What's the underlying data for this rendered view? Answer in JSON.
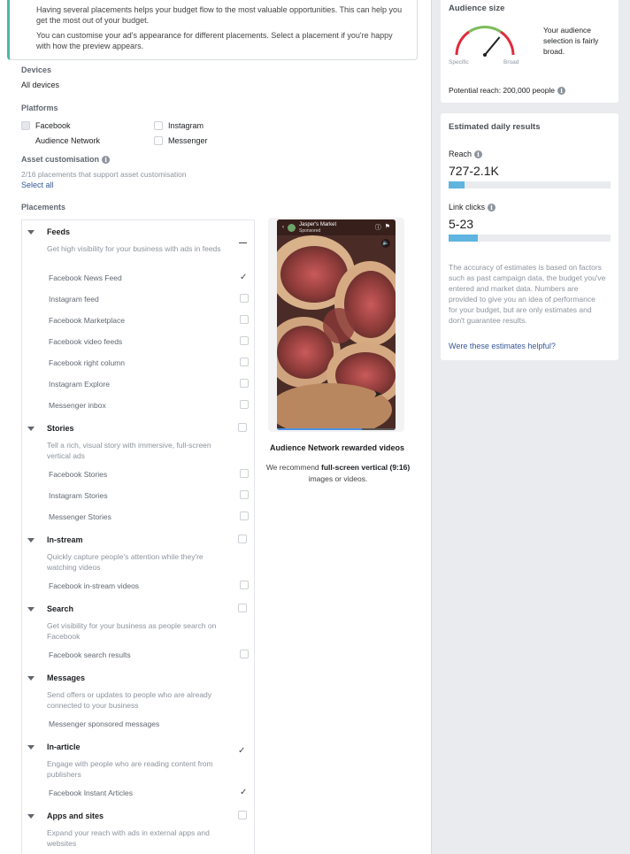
{
  "info_box": {
    "line1": "Having several placements helps your budget flow to the most valuable opportunities. This can help you get the most out of your budget.",
    "line2": "You can customise your ad's appearance for different placements. Select a placement if you're happy with how the preview appears."
  },
  "devices": {
    "label": "Devices",
    "value": "All devices"
  },
  "platforms": {
    "label": "Platforms",
    "items": [
      {
        "label": "Facebook",
        "checked": true
      },
      {
        "label": "Instagram",
        "checked": false
      },
      {
        "label": "Audience Network",
        "checked": false
      },
      {
        "label": "Messenger",
        "checked": false
      }
    ]
  },
  "asset_customisation": {
    "label": "Asset customisation",
    "note": "2/16 placements that support asset customisation",
    "select_all": "Select all"
  },
  "placements": {
    "label": "Placements",
    "groups": [
      {
        "title": "Feeds",
        "desc": "Get high visibility for your business with ads in feeds",
        "items": [
          "Facebook News Feed",
          "Instagram feed",
          "Facebook Marketplace",
          "Facebook video feeds",
          "Facebook right column",
          "Instagram Explore",
          "Messenger inbox"
        ]
      },
      {
        "title": "Stories",
        "desc": "Tell a rich, visual story with immersive, full-screen vertical ads",
        "items": [
          "Facebook Stories",
          "Instagram Stories",
          "Messenger Stories"
        ]
      },
      {
        "title": "In-stream",
        "desc": "Quickly capture people's attention while they're watching videos",
        "items": [
          "Facebook in-stream videos"
        ]
      },
      {
        "title": "Search",
        "desc": "Get visibility for your business as people search on Facebook",
        "items": [
          "Facebook search results"
        ]
      },
      {
        "title": "Messages",
        "desc": "Send offers or updates to people who are already connected to your business",
        "items": [
          "Messenger sponsored messages"
        ]
      },
      {
        "title": "In-article",
        "desc": "Engage with people who are reading content from publishers",
        "items": [
          "Facebook Instant Articles"
        ]
      },
      {
        "title": "Apps and sites",
        "desc": "Expand your reach with ads in external apps and websites",
        "items": []
      }
    ]
  },
  "preview": {
    "page_name": "Jasper's Market",
    "sponsored": "Sponsored",
    "title": "Audience Network rewarded videos",
    "text_before": "We recommend ",
    "text_bold": "full-screen vertical (9:16)",
    "text_after": " images or videos."
  },
  "audience_size": {
    "title": "Audience size",
    "specific": "Specific",
    "broad": "Broad",
    "desc": "Your audience selection is fairly broad.",
    "potential_reach": "Potential reach: 200,000 people",
    "gauge_level": 0.72
  },
  "daily_results": {
    "title": "Estimated daily results",
    "reach_label": "Reach",
    "reach_value": "727-2.1K",
    "reach_fill": 0.1,
    "clicks_label": "Link clicks",
    "clicks_value": "5-23",
    "clicks_fill": 0.18,
    "disclaimer": "The accuracy of estimates is based on factors such as past campaign data, the budget you've entered and market data. Numbers are provided to give you an idea of performance for your budget, but are only estimates and don't guarantee results.",
    "helpful_link": "Were these estimates helpful?"
  },
  "colors": {
    "accent_bar": "#5fb4e0",
    "link": "#385898",
    "info_border": "#4fb6a6"
  }
}
